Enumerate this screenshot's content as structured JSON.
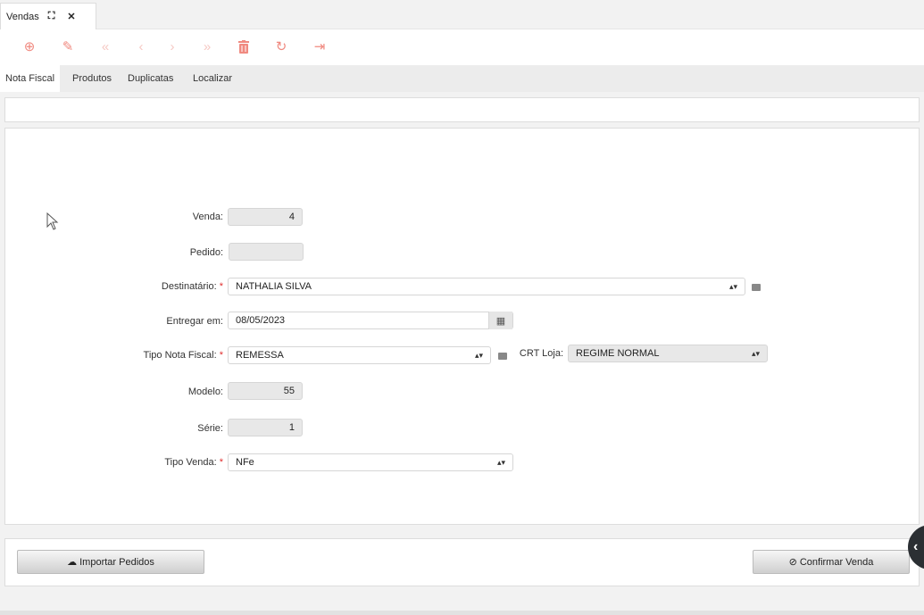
{
  "window": {
    "title": "Vendas",
    "expand_icon": "expand-icon",
    "close_icon": "close-icon"
  },
  "toolbar": {
    "buttons": [
      {
        "name": "add-button",
        "icon": "⊕",
        "enabled": true
      },
      {
        "name": "edit-button",
        "icon": "✎",
        "enabled": true
      },
      {
        "name": "first-button",
        "icon": "«",
        "enabled": false
      },
      {
        "name": "prev-button",
        "icon": "‹",
        "enabled": false
      },
      {
        "name": "next-button",
        "icon": "›",
        "enabled": false
      },
      {
        "name": "last-button",
        "icon": "»",
        "enabled": false
      },
      {
        "name": "delete-button",
        "icon": "🗑",
        "enabled": true
      },
      {
        "name": "refresh-button",
        "icon": "↻",
        "enabled": true
      },
      {
        "name": "exit-button",
        "icon": "⇥",
        "enabled": true
      }
    ],
    "accent_color": "#f08a80"
  },
  "tabs": [
    {
      "label": "Nota Fiscal",
      "active": true
    },
    {
      "label": "Produtos",
      "active": false
    },
    {
      "label": "Duplicatas",
      "active": false
    },
    {
      "label": "Localizar",
      "active": false
    }
  ],
  "form": {
    "venda": {
      "label": "Venda:",
      "value": "4"
    },
    "pedido": {
      "label": "Pedido:",
      "value": ""
    },
    "destinatario": {
      "label": "Destinatário:",
      "required": "*",
      "value": "NATHALIA SILVA"
    },
    "entregar_em": {
      "label": "Entregar em:",
      "value": "08/05/2023"
    },
    "tipo_nota_fiscal": {
      "label": "Tipo Nota Fiscal:",
      "required": "*",
      "value": "REMESSA"
    },
    "crt_loja": {
      "label": "CRT Loja:",
      "value": "REGIME NORMAL"
    },
    "modelo": {
      "label": "Modelo:",
      "value": "55"
    },
    "serie": {
      "label": "Série:",
      "value": "1"
    },
    "tipo_venda": {
      "label": "Tipo Venda:",
      "required": "*",
      "value": "NFe"
    }
  },
  "actions": {
    "importar_pedidos": "Importar Pedidos",
    "confirmar_venda": "Confirmar Venda"
  }
}
